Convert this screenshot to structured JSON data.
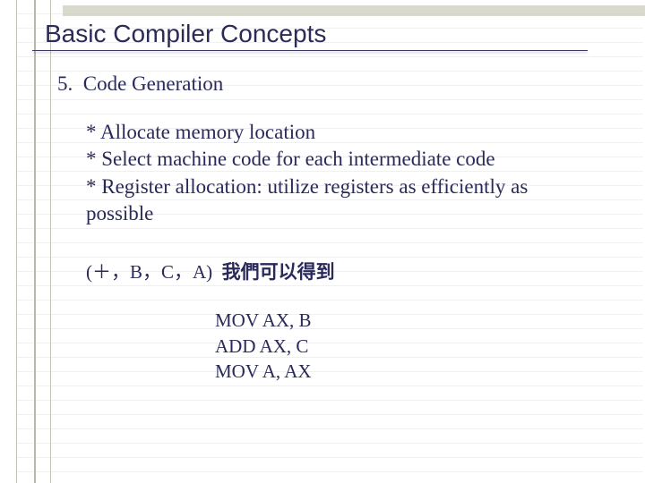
{
  "title": "Basic Compiler Concepts",
  "section": {
    "number": "5.",
    "heading": "Code Generation"
  },
  "bullets": {
    "b1": "* Allocate memory location",
    "b2": "* Select machine code for each intermediate code",
    "b3": "* Register allocation: utilize registers as efficiently as possible"
  },
  "example": {
    "tuple": "(＋，B，C，A)",
    "note": "我們可以得到"
  },
  "asm": {
    "l1": "MOV AX, B",
    "l2": "ADD AX, C",
    "l3": "MOV A, AX"
  }
}
